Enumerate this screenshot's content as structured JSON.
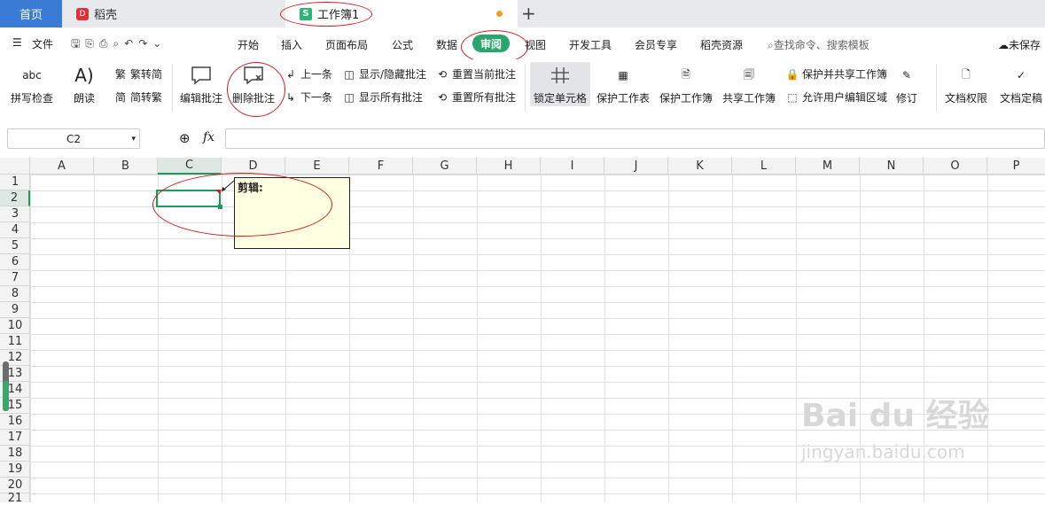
{
  "tabs": {
    "home": "首页",
    "daoke": "稻壳",
    "workbook": "工作簿1"
  },
  "menu": {
    "file": "文件",
    "items": [
      "开始",
      "插入",
      "页面布局",
      "公式",
      "数据",
      "审阅",
      "视图",
      "开发工具",
      "会员专享",
      "稻壳资源"
    ],
    "search": "查找命令、搜索模板",
    "unsaved": "未保存"
  },
  "ribbon": {
    "spell": "拼写检查",
    "read": "朗读",
    "t2s": "繁转简",
    "s2t": "简转繁",
    "edit_comment": "编辑批注",
    "delete_comment": "删除批注",
    "prev": "上一条",
    "next": "下一条",
    "show_hide": "显示/隐藏批注",
    "show_all": "显示所有批注",
    "reset_current": "重置当前批注",
    "reset_all": "重置所有批注",
    "lock_cell": "锁定单元格",
    "protect_sheet": "保护工作表",
    "protect_book": "保护工作簿",
    "share_book": "共享工作簿",
    "protect_share": "保护并共享工作簿",
    "allow_edit": "允许用户编辑区域",
    "revise": "修订",
    "doc_perm": "文档权限",
    "doc_final": "文档定稿"
  },
  "formula": {
    "namebox": "C2",
    "fx": "fx"
  },
  "columns": [
    "A",
    "B",
    "C",
    "D",
    "E",
    "F",
    "G",
    "H",
    "I",
    "J",
    "K",
    "L",
    "M",
    "N",
    "O",
    "P"
  ],
  "rows": [
    "1",
    "2",
    "3",
    "4",
    "5",
    "6",
    "7",
    "8",
    "9",
    "10",
    "11",
    "12",
    "13",
    "14",
    "15",
    "16",
    "17",
    "18",
    "19",
    "20",
    "21"
  ],
  "comment_text": "剪辑:",
  "watermark": {
    "line1": "Bai du 经验",
    "line2": "jingyan.baidu.com"
  },
  "colors": {
    "accent": "#28a66b",
    "home_tab": "#3a7bd5",
    "annotation": "#d01c1c"
  }
}
